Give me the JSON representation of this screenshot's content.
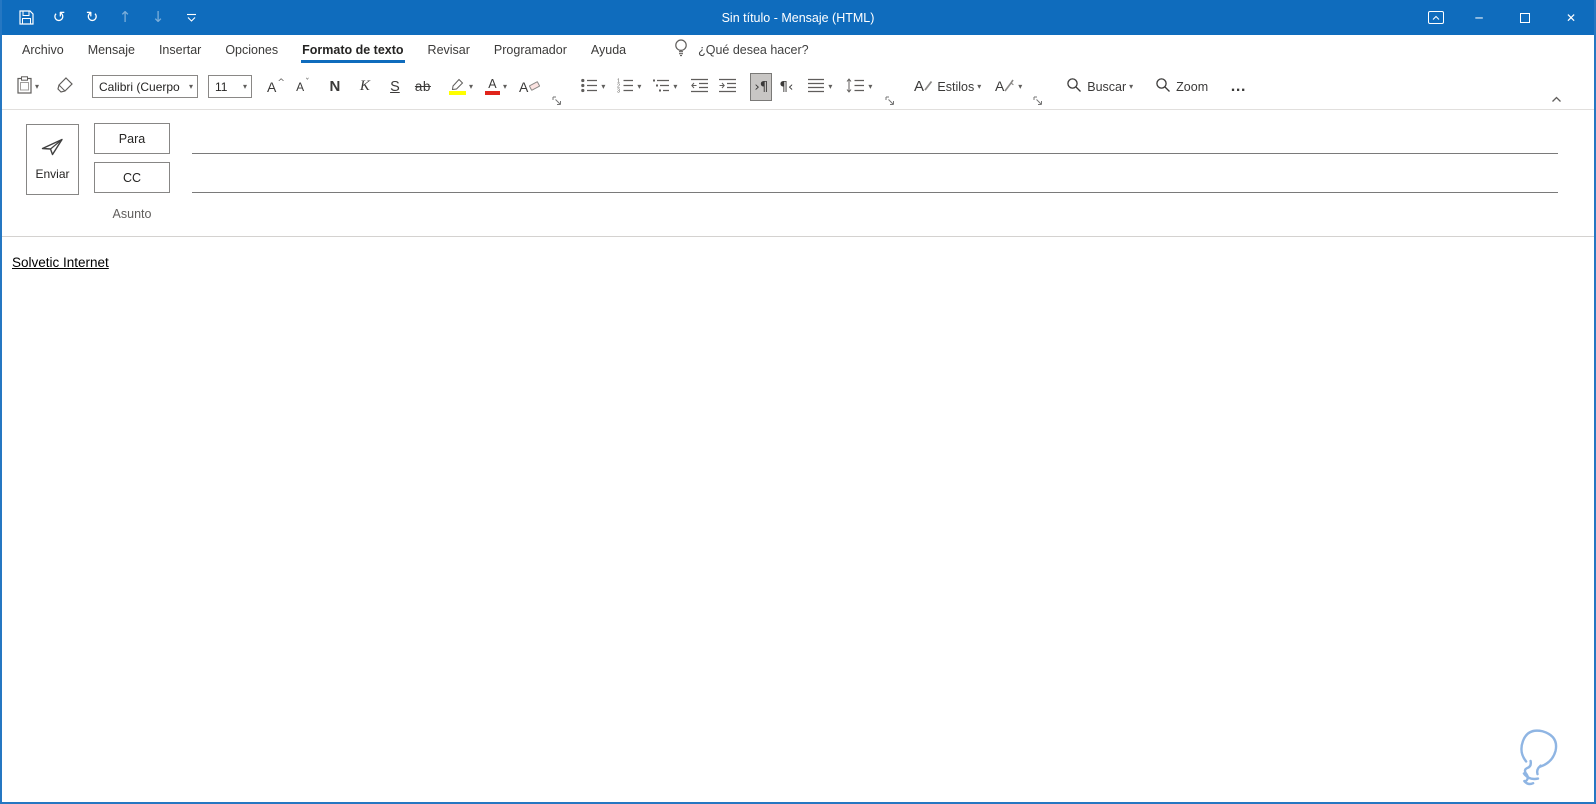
{
  "colors": {
    "titlebar_blue": "#0f6cbd",
    "accent_blue": "#0f6cbd",
    "highlight_yellow": "#ffff00",
    "font_color_red": "#e0241b",
    "selected_button_bg": "#c8c6c4",
    "doodle_blue": "#8fb5e3"
  },
  "titlebar": {
    "title": "Sin título  -  Mensaje (HTML)"
  },
  "icons": {
    "undo": "↺",
    "redo": "↻",
    "up_arrow": "↑",
    "down_arrow": "↓",
    "chevron_down": "▾",
    "minimize": "─",
    "close": "✕",
    "grow_font_caret": "^",
    "shrink_font_caret": "ˇ",
    "letter_a": "A",
    "pilcrow_ltr": "›¶",
    "pilcrow_rtl": "¶‹",
    "ellipsis": "…"
  },
  "menu": {
    "tabs": [
      {
        "label": "Archivo"
      },
      {
        "label": "Mensaje"
      },
      {
        "label": "Insertar"
      },
      {
        "label": "Opciones"
      },
      {
        "label": "Formato de texto"
      },
      {
        "label": "Revisar"
      },
      {
        "label": "Programador"
      },
      {
        "label": "Ayuda"
      }
    ],
    "tell_me_label": "¿Qué desea hacer?"
  },
  "ribbon": {
    "font_name_value": "Calibri (Cuerpo",
    "font_size_value": "11",
    "bold_label": "N",
    "italic_label": "K",
    "underline_label": "S",
    "strikethrough_label": "ab",
    "font_color_label": "A",
    "clear_format_label": "A",
    "styles_label": "Estilos",
    "search_label": "Buscar",
    "zoom_label": "Zoom"
  },
  "compose": {
    "send_label": "Enviar",
    "to_label": "Para",
    "cc_label": "CC",
    "subject_label": "Asunto",
    "to_value": "",
    "cc_value": "",
    "subject_value": ""
  },
  "body": {
    "text": "Solvetic Internet"
  }
}
